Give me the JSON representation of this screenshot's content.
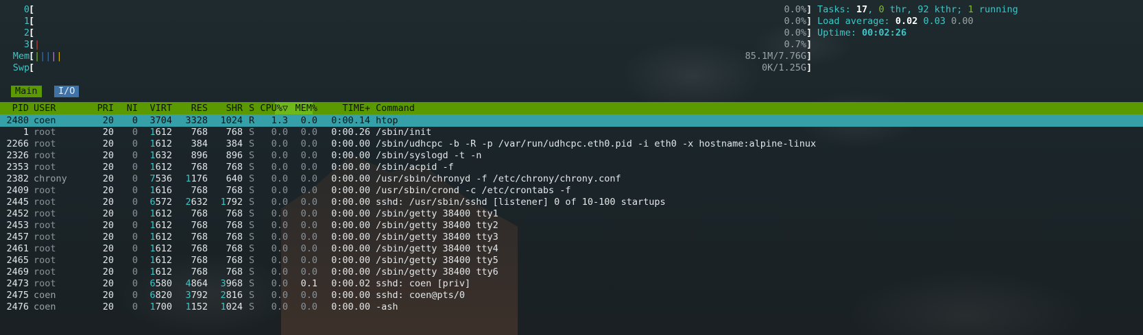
{
  "meters": {
    "cpus": [
      {
        "label": "0",
        "value": "0.0%"
      },
      {
        "label": "1",
        "value": "0.0%"
      },
      {
        "label": "2",
        "value": "0.0%"
      },
      {
        "label": "3",
        "value": "0.7%"
      }
    ],
    "mem": {
      "label": "Mem",
      "value": "85.1M/7.76G"
    },
    "swp": {
      "label": "Swp",
      "value": "0K/1.25G"
    }
  },
  "summary": {
    "tasks_label": "Tasks:",
    "tasks": "17",
    "thr": "0",
    "thr_label": "thr,",
    "kthr": "92",
    "kthr_label": "kthr;",
    "running": "1",
    "running_label": "running",
    "load_label": "Load average:",
    "load1": "0.02",
    "load5": "0.03",
    "load15": "0.00",
    "uptime_label": "Uptime:",
    "uptime": "00:02:26"
  },
  "tabs": [
    {
      "label": "Main"
    },
    {
      "label": "I/O"
    }
  ],
  "columns": [
    "PID",
    "USER",
    "PRI",
    "NI",
    "VIRT",
    "RES",
    "SHR",
    "S",
    "CPU%▽",
    "MEM%",
    "TIME+",
    "Command"
  ],
  "processes": [
    {
      "pid": "2480",
      "user": "coen",
      "pri": "20",
      "ni": "0",
      "virt": "3704",
      "res": "3328",
      "shr": "1024",
      "s": "R",
      "cpu": "1.3",
      "mem": "0.0",
      "time": "0:00.14",
      "cmd": "htop"
    },
    {
      "pid": "1",
      "user": "root",
      "pri": "20",
      "ni": "0",
      "virt": "1612",
      "res": "768",
      "shr": "768",
      "s": "S",
      "cpu": "0.0",
      "mem": "0.0",
      "time": "0:00.26",
      "cmd": "/sbin/init"
    },
    {
      "pid": "2266",
      "user": "root",
      "pri": "20",
      "ni": "0",
      "virt": "1612",
      "res": "384",
      "shr": "384",
      "s": "S",
      "cpu": "0.0",
      "mem": "0.0",
      "time": "0:00.00",
      "cmd": "/sbin/udhcpc -b -R -p /var/run/udhcpc.eth0.pid -i eth0 -x hostname:alpine-linux"
    },
    {
      "pid": "2326",
      "user": "root",
      "pri": "20",
      "ni": "0",
      "virt": "1632",
      "res": "896",
      "shr": "896",
      "s": "S",
      "cpu": "0.0",
      "mem": "0.0",
      "time": "0:00.00",
      "cmd": "/sbin/syslogd -t -n"
    },
    {
      "pid": "2353",
      "user": "root",
      "pri": "20",
      "ni": "0",
      "virt": "1612",
      "res": "768",
      "shr": "768",
      "s": "S",
      "cpu": "0.0",
      "mem": "0.0",
      "time": "0:00.00",
      "cmd": "/sbin/acpid -f"
    },
    {
      "pid": "2382",
      "user": "chrony",
      "pri": "20",
      "ni": "0",
      "virt": "7536",
      "res": "1176",
      "shr": "640",
      "s": "S",
      "cpu": "0.0",
      "mem": "0.0",
      "time": "0:00.00",
      "cmd": "/usr/sbin/chronyd -f /etc/chrony/chrony.conf"
    },
    {
      "pid": "2409",
      "user": "root",
      "pri": "20",
      "ni": "0",
      "virt": "1616",
      "res": "768",
      "shr": "768",
      "s": "S",
      "cpu": "0.0",
      "mem": "0.0",
      "time": "0:00.00",
      "cmd": "/usr/sbin/crond -c /etc/crontabs -f"
    },
    {
      "pid": "2445",
      "user": "root",
      "pri": "20",
      "ni": "0",
      "virt": "6572",
      "res": "2632",
      "shr": "1792",
      "s": "S",
      "cpu": "0.0",
      "mem": "0.0",
      "time": "0:00.00",
      "cmd": "sshd: /usr/sbin/sshd [listener] 0 of 10-100 startups"
    },
    {
      "pid": "2452",
      "user": "root",
      "pri": "20",
      "ni": "0",
      "virt": "1612",
      "res": "768",
      "shr": "768",
      "s": "S",
      "cpu": "0.0",
      "mem": "0.0",
      "time": "0:00.00",
      "cmd": "/sbin/getty 38400 tty1"
    },
    {
      "pid": "2453",
      "user": "root",
      "pri": "20",
      "ni": "0",
      "virt": "1612",
      "res": "768",
      "shr": "768",
      "s": "S",
      "cpu": "0.0",
      "mem": "0.0",
      "time": "0:00.00",
      "cmd": "/sbin/getty 38400 tty2"
    },
    {
      "pid": "2457",
      "user": "root",
      "pri": "20",
      "ni": "0",
      "virt": "1612",
      "res": "768",
      "shr": "768",
      "s": "S",
      "cpu": "0.0",
      "mem": "0.0",
      "time": "0:00.00",
      "cmd": "/sbin/getty 38400 tty3"
    },
    {
      "pid": "2461",
      "user": "root",
      "pri": "20",
      "ni": "0",
      "virt": "1612",
      "res": "768",
      "shr": "768",
      "s": "S",
      "cpu": "0.0",
      "mem": "0.0",
      "time": "0:00.00",
      "cmd": "/sbin/getty 38400 tty4"
    },
    {
      "pid": "2465",
      "user": "root",
      "pri": "20",
      "ni": "0",
      "virt": "1612",
      "res": "768",
      "shr": "768",
      "s": "S",
      "cpu": "0.0",
      "mem": "0.0",
      "time": "0:00.00",
      "cmd": "/sbin/getty 38400 tty5"
    },
    {
      "pid": "2469",
      "user": "root",
      "pri": "20",
      "ni": "0",
      "virt": "1612",
      "res": "768",
      "shr": "768",
      "s": "S",
      "cpu": "0.0",
      "mem": "0.0",
      "time": "0:00.00",
      "cmd": "/sbin/getty 38400 tty6"
    },
    {
      "pid": "2473",
      "user": "root",
      "pri": "20",
      "ni": "0",
      "virt": "6580",
      "res": "4864",
      "shr": "3968",
      "s": "S",
      "cpu": "0.0",
      "mem": "0.1",
      "time": "0:00.02",
      "cmd": "sshd: coen [priv]"
    },
    {
      "pid": "2475",
      "user": "coen",
      "pri": "20",
      "ni": "0",
      "virt": "6820",
      "res": "3792",
      "shr": "2816",
      "s": "S",
      "cpu": "0.0",
      "mem": "0.0",
      "time": "0:00.00",
      "cmd": "sshd: coen@pts/0"
    },
    {
      "pid": "2476",
      "user": "coen",
      "pri": "20",
      "ni": "0",
      "virt": "1700",
      "res": "1152",
      "shr": "1024",
      "s": "S",
      "cpu": "0.0",
      "mem": "0.0",
      "time": "0:00.00",
      "cmd": "-ash"
    }
  ],
  "colors": {
    "header_bg": "#5a9a00",
    "selected_bg": "#35a0a8",
    "tab_io_bg": "#3f73a8",
    "accent_cyan": "#3ec6c6",
    "accent_green": "#7fc21b"
  }
}
